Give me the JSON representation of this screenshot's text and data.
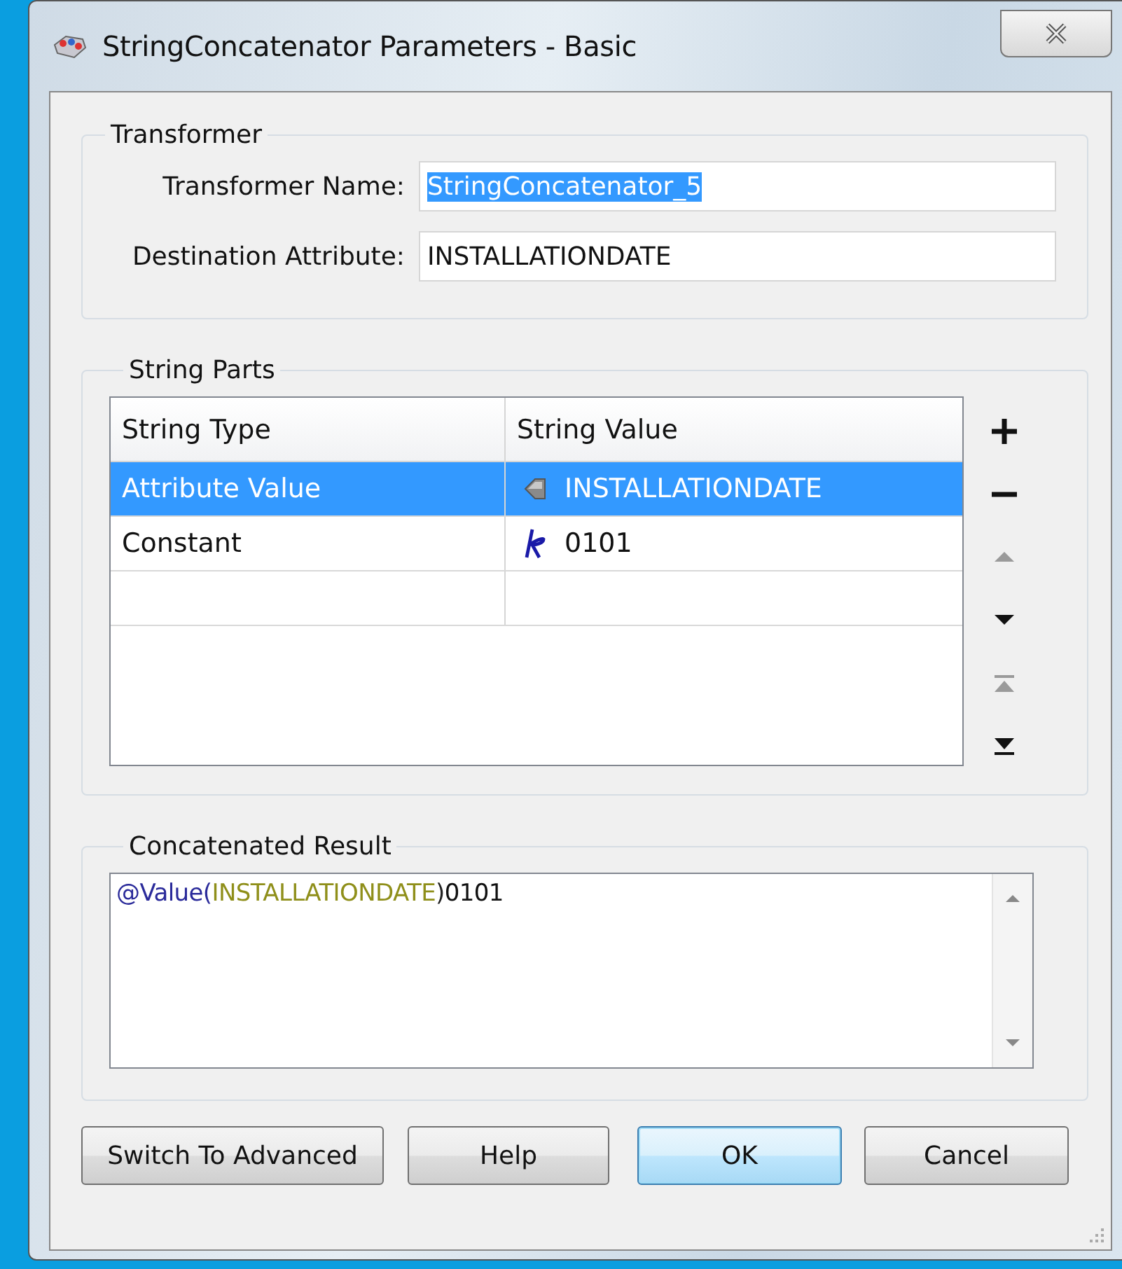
{
  "window": {
    "title": "StringConcatenator Parameters - Basic"
  },
  "transformer": {
    "legend": "Transformer",
    "fields": [
      {
        "label": "Transformer Name:",
        "value": "StringConcatenator_5",
        "selected": true
      },
      {
        "label": "Destination Attribute:",
        "value": "INSTALLATIONDATE",
        "selected": false
      }
    ]
  },
  "string_parts": {
    "legend": "String Parts",
    "columns": [
      "String Type",
      "String Value"
    ],
    "rows": [
      {
        "type": "Attribute Value",
        "value": "INSTALLATIONDATE",
        "kind": "attribute",
        "selected": true
      },
      {
        "type": "Constant",
        "value": "0101",
        "kind": "constant",
        "selected": false
      }
    ],
    "side_buttons": [
      {
        "kind": "add",
        "disabled": false
      },
      {
        "kind": "remove",
        "disabled": false
      },
      {
        "kind": "up",
        "disabled": true
      },
      {
        "kind": "down",
        "disabled": false
      },
      {
        "kind": "top",
        "disabled": true
      },
      {
        "kind": "bottom",
        "disabled": false
      }
    ]
  },
  "result": {
    "legend": "Concatenated Result",
    "tokens": [
      {
        "text": "@Value",
        "kind": "function"
      },
      {
        "text": "(",
        "kind": "bracket"
      },
      {
        "text": "INSTALLATIONDATE",
        "kind": "attribute"
      },
      {
        "text": ")",
        "kind": "bracket"
      },
      {
        "text": "0101",
        "kind": "literal"
      }
    ]
  },
  "buttons": [
    {
      "label": "Switch To Advanced",
      "default": false
    },
    {
      "label": "Help",
      "default": false
    },
    {
      "label": "OK",
      "default": true
    },
    {
      "label": "Cancel",
      "default": false
    }
  ]
}
